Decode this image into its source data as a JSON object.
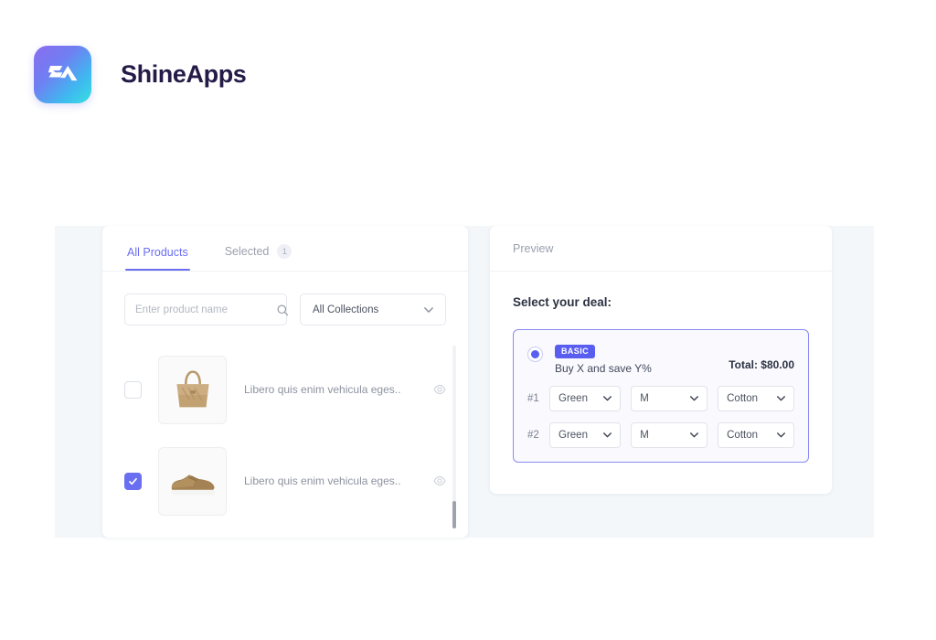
{
  "brand": {
    "name": "ShineApps",
    "logo_icon": "shineapps-sa-monogram",
    "gradient_from": "#8b6cf0",
    "gradient_to": "#35e0e0"
  },
  "products_panel": {
    "tabs": [
      {
        "label": "All Products",
        "active": true,
        "badge": ""
      },
      {
        "label": "Selected",
        "active": false,
        "badge": "1"
      }
    ],
    "search": {
      "placeholder": "Enter product name",
      "value": "",
      "icon": "search-icon"
    },
    "collections": {
      "selected": "All Collections",
      "icon": "chevron-down-icon"
    },
    "rows": [
      {
        "checked": false,
        "name": "Libero quis enim vehicula eges..",
        "image": "tan-handbag",
        "eye_icon": "eye-icon"
      },
      {
        "checked": true,
        "name": "Libero quis enim vehicula eges..",
        "image": "brown-sneaker",
        "eye_icon": "eye-icon"
      }
    ]
  },
  "preview_panel": {
    "title": "Preview",
    "deal_prompt": "Select your deal:",
    "deal": {
      "selected": true,
      "badge": "BASIC",
      "description": "Buy X and save Y%",
      "total": "Total:  $80.00",
      "accent_color": "#5a5ef0",
      "variants": [
        {
          "num": "#1",
          "color": "Green",
          "size": "M",
          "material": "Cotton"
        },
        {
          "num": "#2",
          "color": "Green",
          "size": "M",
          "material": "Cotton"
        }
      ]
    }
  }
}
